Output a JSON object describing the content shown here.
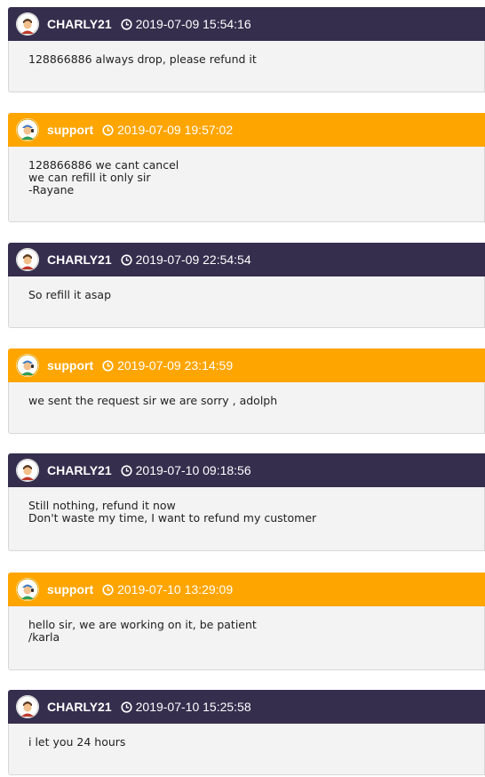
{
  "messages": [
    {
      "role": "user",
      "author": "CHARLY21",
      "timestamp": "2019-07-09 15:54:16",
      "lines": [
        "128866886 always drop, please refund it"
      ]
    },
    {
      "role": "support",
      "author": "support",
      "timestamp": "2019-07-09 19:57:02",
      "lines": [
        "128866886 we cant cancel",
        "we can refill it only sir",
        "-Rayane"
      ]
    },
    {
      "role": "user",
      "author": "CHARLY21",
      "timestamp": "2019-07-09 22:54:54",
      "lines": [
        "So refill it asap"
      ]
    },
    {
      "role": "support",
      "author": "support",
      "timestamp": "2019-07-09 23:14:59",
      "lines": [
        "we sent the request sir we are sorry , adolph"
      ]
    },
    {
      "role": "user",
      "author": "CHARLY21",
      "timestamp": "2019-07-10 09:18:56",
      "lines": [
        "Still nothing, refund it now",
        "Don't waste my time, I want to refund my customer"
      ]
    },
    {
      "role": "support",
      "author": "support",
      "timestamp": "2019-07-10 13:29:09",
      "lines": [
        "hello sir, we are working on it, be patient",
        "/karla"
      ]
    },
    {
      "role": "user",
      "author": "CHARLY21",
      "timestamp": "2019-07-10 15:25:58",
      "lines": [
        "i let you 24 hours"
      ]
    }
  ],
  "colors": {
    "user_header": "#352e4d",
    "support_header": "#ffa500",
    "body_background": "#f3f3f3"
  },
  "icons": {
    "user_avatar": "user-avatar-icon",
    "support_avatar": "support-avatar-icon",
    "timestamp": "clock-icon"
  }
}
